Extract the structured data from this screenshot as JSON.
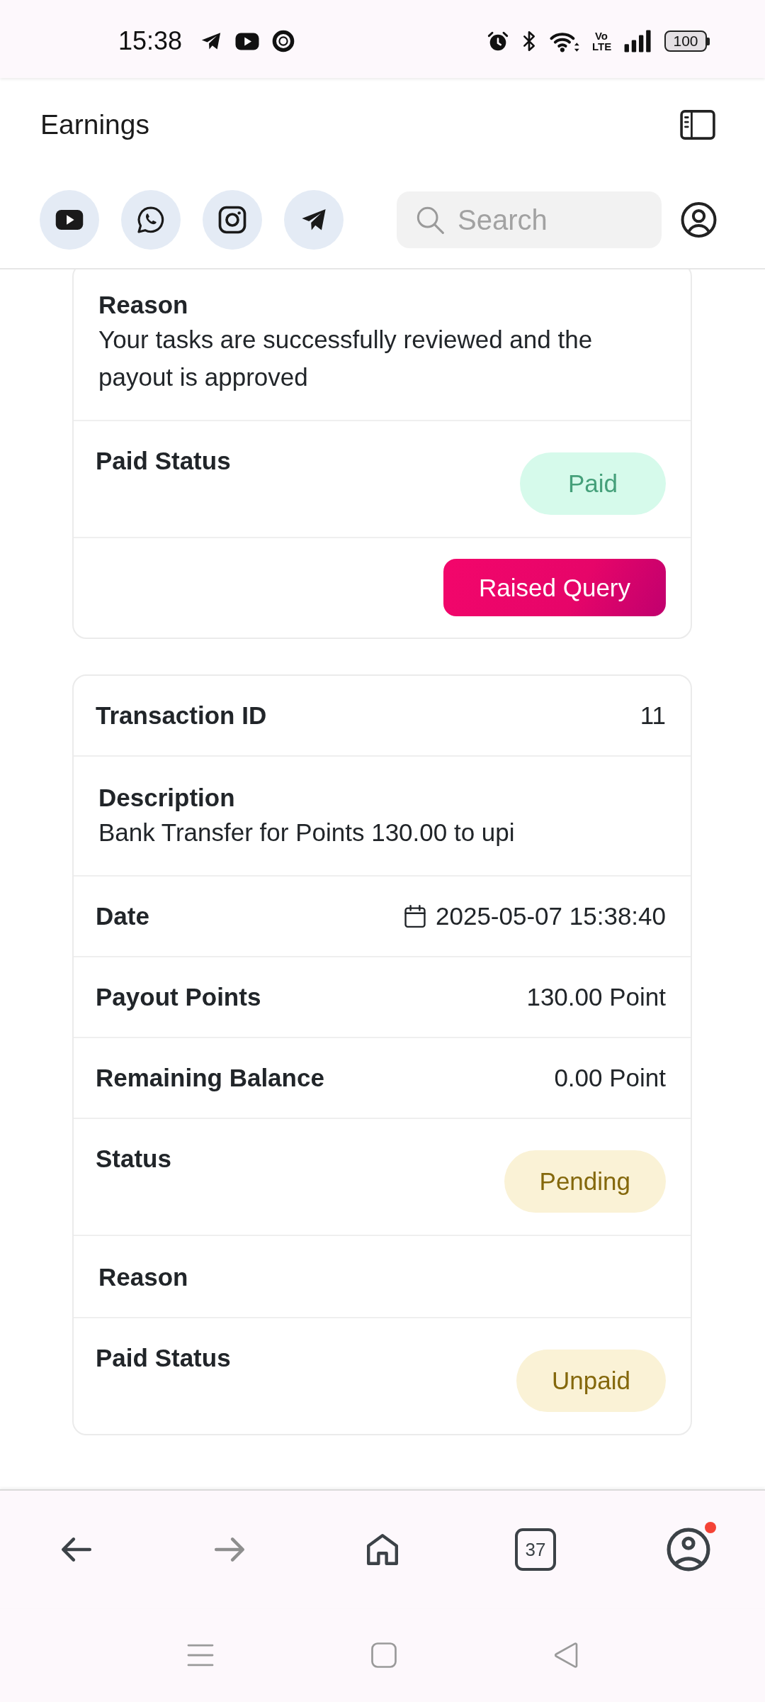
{
  "status_bar": {
    "time": "15:38",
    "network_type": "Vo LTE",
    "battery": "100"
  },
  "header": {
    "title": "Earnings"
  },
  "search": {
    "placeholder": "Search"
  },
  "cards": [
    {
      "rows": [
        {
          "kind": "stacked",
          "label": "Reason",
          "value": "Your tasks are successfully reviewed and the payout is approved"
        },
        {
          "kind": "badge",
          "label": "Paid Status",
          "badge": {
            "text": "Paid",
            "color": "#45a07a"
          }
        },
        {
          "kind": "action",
          "button": "Raised Query"
        }
      ]
    },
    {
      "rows": [
        {
          "kind": "pair",
          "label": "Transaction ID",
          "value": "11"
        },
        {
          "kind": "stacked",
          "label": "Description",
          "value": "Bank Transfer for Points 130.00 to upi"
        },
        {
          "kind": "date",
          "label": "Date",
          "value": "2025-05-07 15:38:40"
        },
        {
          "kind": "pair",
          "label": "Payout Points",
          "value": "130.00 Point"
        },
        {
          "kind": "pair",
          "label": "Remaining Balance",
          "value": "0.00 Point"
        },
        {
          "kind": "badge",
          "label": "Status",
          "badge": {
            "text": "Pending",
            "color": "#84680c"
          }
        },
        {
          "kind": "stacked",
          "label": "Reason"
        },
        {
          "kind": "badge",
          "label": "Paid Status",
          "badge": {
            "text": "Unpaid",
            "color": "#84680c"
          }
        }
      ]
    }
  ],
  "browser_toolbar": {
    "buttons": [
      {
        "kind": "back",
        "disabled": false
      },
      {
        "kind": "forward",
        "disabled": true
      },
      {
        "kind": "home",
        "disabled": false
      },
      {
        "kind": "tabs",
        "count": "37",
        "disabled": false
      },
      {
        "kind": "account",
        "disabled": false,
        "notification": true
      }
    ]
  }
}
